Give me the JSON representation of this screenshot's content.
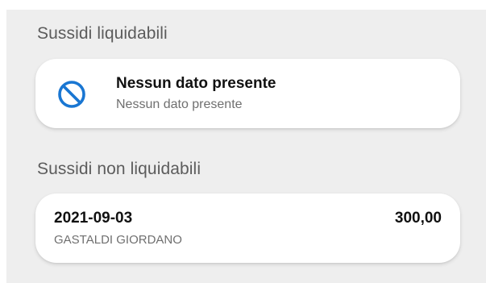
{
  "sections": {
    "liquidabili": {
      "title": "Sussidi liquidabili",
      "empty_state": {
        "icon": "block-icon",
        "icon_color": "#1976d2",
        "title": "Nessun dato presente",
        "subtitle": "Nessun dato presente"
      }
    },
    "non_liquidabili": {
      "title": "Sussidi non liquidabili",
      "items": [
        {
          "date": "2021-09-03",
          "amount": "300,00",
          "name": "GASTALDI GIORDANO"
        }
      ]
    }
  },
  "colors": {
    "background": "#eeeeee",
    "card": "#ffffff",
    "accent": "#1976d2"
  }
}
